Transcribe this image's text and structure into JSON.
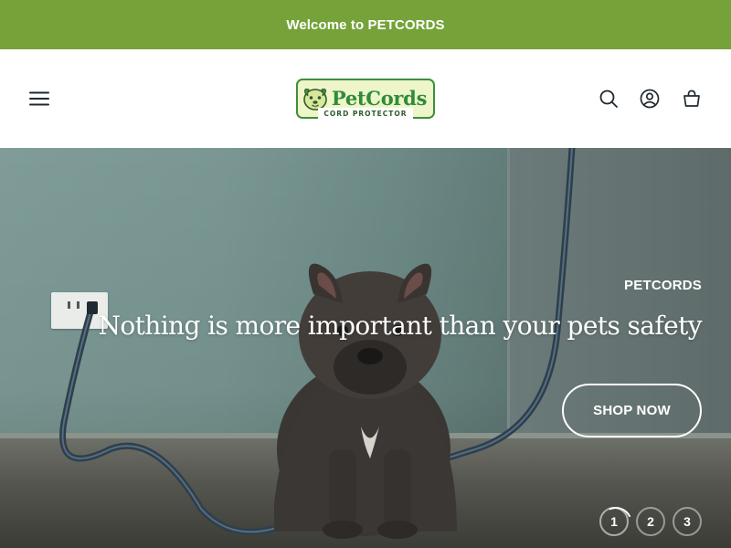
{
  "colors": {
    "announcement_bg": "#75a33a",
    "header_bg": "#ffffff",
    "icon_color": "#1f2a30",
    "logo_green": "#2f8c3a",
    "logo_bg": "#eef5c8"
  },
  "announcement": {
    "text": "Welcome to PETCORDS"
  },
  "header": {
    "logo": {
      "word": "PetCords",
      "tagline": "CORD PROTECTOR",
      "icon": "dog-face-icon"
    },
    "icons": {
      "menu": "hamburger-menu-icon",
      "search": "search-icon",
      "account": "account-icon",
      "cart": "cart-icon"
    }
  },
  "hero": {
    "eyebrow": "PETCORDS",
    "headline": "Nothing is more important than your pets safety",
    "cta": "SHOP NOW",
    "pagination": [
      "1",
      "2",
      "3"
    ],
    "active_slide": "1"
  }
}
